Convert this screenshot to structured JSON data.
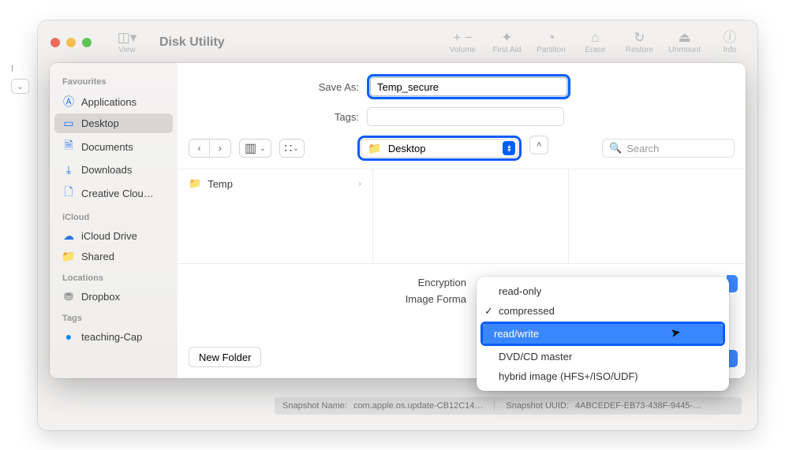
{
  "window": {
    "title": "Disk Utility",
    "view_label": "View",
    "volume_label": "Volume",
    "first_aid_label": "First Aid",
    "partition_label": "Partition",
    "erase_label": "Erase",
    "restore_label": "Restore",
    "unmount_label": "Unmount",
    "info_label": "Info"
  },
  "sidebar": {
    "favourites_heading": "Favourites",
    "favourites": [
      {
        "icon": "applications",
        "label": "Applications"
      },
      {
        "icon": "desktop",
        "label": "Desktop"
      },
      {
        "icon": "documents",
        "label": "Documents"
      },
      {
        "icon": "downloads",
        "label": "Downloads"
      },
      {
        "icon": "creativecloud",
        "label": "Creative Clou…"
      }
    ],
    "icloud_heading": "iCloud",
    "icloud": [
      {
        "icon": "iclouddrive",
        "label": "iCloud Drive"
      },
      {
        "icon": "shared",
        "label": "Shared"
      }
    ],
    "locations_heading": "Locations",
    "locations": [
      {
        "icon": "dropbox",
        "label": "Dropbox"
      }
    ],
    "tags_heading": "Tags",
    "tags": [
      {
        "label": "teaching-Cap"
      }
    ]
  },
  "save": {
    "save_as_label": "Save As:",
    "save_as_value": "Temp_secure",
    "tags_label": "Tags:",
    "location_label": "Desktop",
    "search_placeholder": "Search",
    "browser_item": "Temp",
    "encryption_label": "Encryption",
    "image_format_label": "Image Forma",
    "new_folder_label": "New Folder"
  },
  "format_menu": {
    "options": [
      "read-only",
      "compressed",
      "read/write",
      "DVD/CD master",
      "hybrid image (HFS+/ISO/UDF)"
    ],
    "current_index": 1,
    "highlighted_index": 2
  },
  "snapshot": {
    "name_label": "Snapshot Name:",
    "name_value": "com.apple.os.update-CB12C14…",
    "uuid_label": "Snapshot UUID:",
    "uuid_value": "4ABCEDEF-EB73-438F-9445-…"
  }
}
